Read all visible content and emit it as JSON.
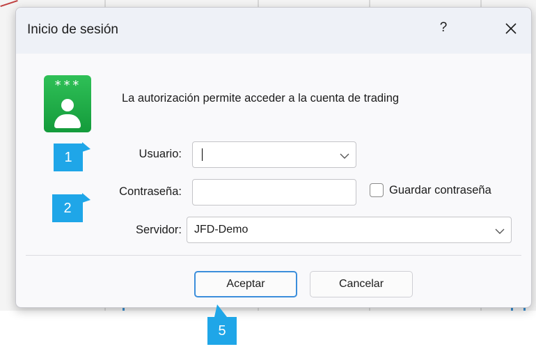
{
  "dialog": {
    "title": "Inicio de sesión",
    "help_label": "?",
    "info_text": "La autorización permite acceder a la cuenta de trading",
    "icon_stars": "***"
  },
  "form": {
    "usuario_label": "Usuario:",
    "usuario_value": "",
    "password_label": "Contraseña:",
    "password_value": "",
    "save_password_label": "Guardar contraseña",
    "save_password_checked": false,
    "server_label": "Servidor:",
    "server_value": "JFD-Demo"
  },
  "buttons": {
    "accept_label": "Aceptar",
    "cancel_label": "Cancelar"
  },
  "annotations": {
    "step1": "1",
    "step2": "2",
    "step5": "5"
  },
  "colors": {
    "badge": "#1fa6e8",
    "accent": "#3b8edb",
    "icon_green": "#1fae48"
  }
}
